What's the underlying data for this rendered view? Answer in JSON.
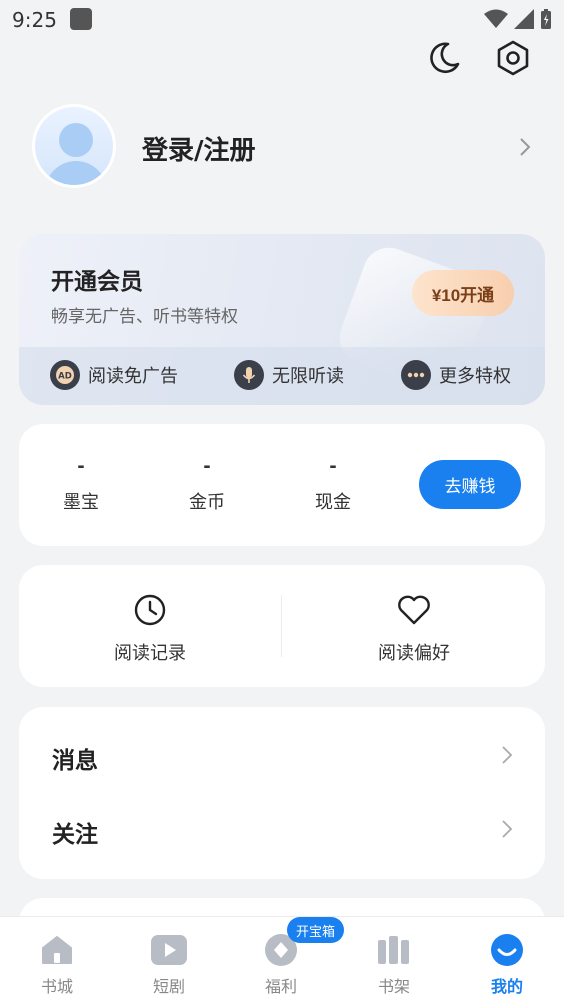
{
  "status_bar": {
    "time": "9:25"
  },
  "profile": {
    "login_label": "登录/注册"
  },
  "vip": {
    "title": "开通会员",
    "subtitle": "畅享无广告、听书等特权",
    "button": "¥10开通",
    "perks": [
      {
        "label": "阅读免广告",
        "icon": "ad-free-icon",
        "icon_text": "AD"
      },
      {
        "label": "无限听读",
        "icon": "microphone-icon"
      },
      {
        "label": "更多特权",
        "icon": "more-dots-icon"
      }
    ]
  },
  "wallet": {
    "stats": [
      {
        "value": "-",
        "label": "墨宝"
      },
      {
        "value": "-",
        "label": "金币"
      },
      {
        "value": "-",
        "label": "现金"
      }
    ],
    "earn_button": "去赚钱"
  },
  "history": {
    "items": [
      {
        "label": "阅读记录",
        "icon": "clock-icon"
      },
      {
        "label": "阅读偏好",
        "icon": "heart-icon"
      }
    ]
  },
  "menu": {
    "items": [
      {
        "label": "消息"
      },
      {
        "label": "关注"
      }
    ]
  },
  "tabbar": {
    "badge": "开宝箱",
    "tabs": [
      {
        "label": "书城",
        "icon": "home-icon"
      },
      {
        "label": "短剧",
        "icon": "play-icon"
      },
      {
        "label": "福利",
        "icon": "gift-icon"
      },
      {
        "label": "书架",
        "icon": "bookshelf-icon"
      },
      {
        "label": "我的",
        "icon": "profile-icon",
        "active": true
      }
    ]
  },
  "colors": {
    "accent": "#1a80f0",
    "vip_button": "#f8cfae",
    "background": "#f2f3f5"
  }
}
